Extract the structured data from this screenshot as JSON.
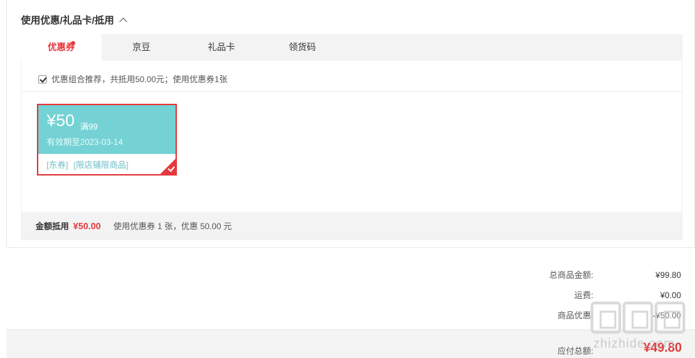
{
  "section": {
    "title": "使用优惠/礼品卡/抵用"
  },
  "tabs": [
    {
      "label": "优惠券",
      "active": true,
      "badge": true
    },
    {
      "label": "京豆",
      "active": false
    },
    {
      "label": "礼品卡",
      "active": false
    },
    {
      "label": "领货码",
      "active": false
    }
  ],
  "recommend": {
    "checked": true,
    "text": "优惠组合推荐，共抵用50.00元；使用优惠券1张"
  },
  "coupon": {
    "amount": "¥50",
    "condition": "满99",
    "expiry": "有效期至2023-03-14",
    "tags": [
      "[东券]",
      "[限店铺限商品]"
    ],
    "selected": true
  },
  "summary": {
    "label": "金额抵用",
    "amount": "¥50.00",
    "desc": "使用优惠券 1 张，优惠 50.00 元"
  },
  "totals": {
    "goods_label": "总商品金额:",
    "goods_value": "¥99.80",
    "shipping_label": "运费:",
    "shipping_value": "¥0.00",
    "discount_label": "商品优惠:",
    "discount_value": "-¥50.00"
  },
  "pay": {
    "label": "应付总额:",
    "value": "¥49.80"
  },
  "watermark": {
    "text": "zhizhide.com"
  },
  "colors": {
    "accent": "#e4393c",
    "coupon": "#74d2d4"
  }
}
